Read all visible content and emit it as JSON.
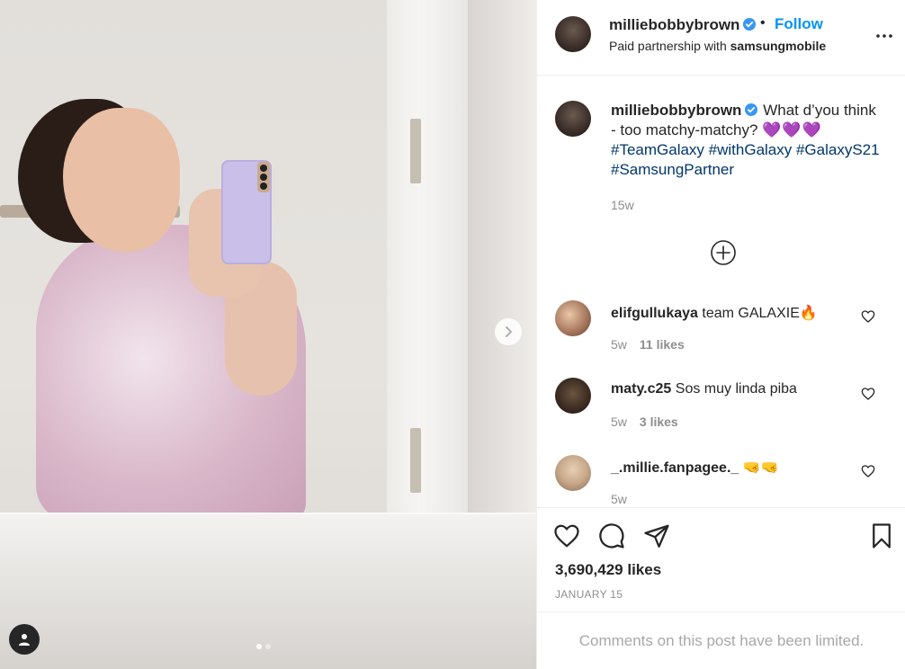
{
  "post": {
    "author": "milliebobbybrown",
    "follow_separator": "•",
    "follow_label": "Follow",
    "partnership_prefix": "Paid partnership with",
    "partnership_brand": "samsungmobile"
  },
  "caption": {
    "username": "milliebobbybrown",
    "text": "What d’you think - too matchy-matchy?",
    "hearts": "💜💜💜",
    "hashtags": "#TeamGalaxy #withGalaxy #GalaxyS21 #SamsungPartner",
    "time": "15w"
  },
  "comments": [
    {
      "username": "elifgullukaya",
      "text": "team GALAXIE🔥",
      "time": "5w",
      "likes": "11 likes"
    },
    {
      "username": "maty.c25",
      "text": "Sos muy linda piba",
      "time": "5w",
      "likes": "3 likes"
    },
    {
      "username": "_.millie.fanpagee._",
      "text": "🤜🤜",
      "time": "5w",
      "likes": ""
    }
  ],
  "stats": {
    "likes": "3,690,429 likes",
    "date": "JANUARY 15"
  },
  "footer": {
    "limited": "Comments on this post have been limited."
  },
  "icons": [
    "verified-badge-icon",
    "more-options-icon",
    "load-more-plus-icon",
    "heart-icon",
    "comment-icon",
    "share-icon",
    "bookmark-icon",
    "chevron-right-icon",
    "user-tag-icon"
  ],
  "colors": {
    "accent": "#0095f6",
    "hashtag": "#00376b",
    "muted": "#8e8e8e",
    "text": "#262626"
  }
}
